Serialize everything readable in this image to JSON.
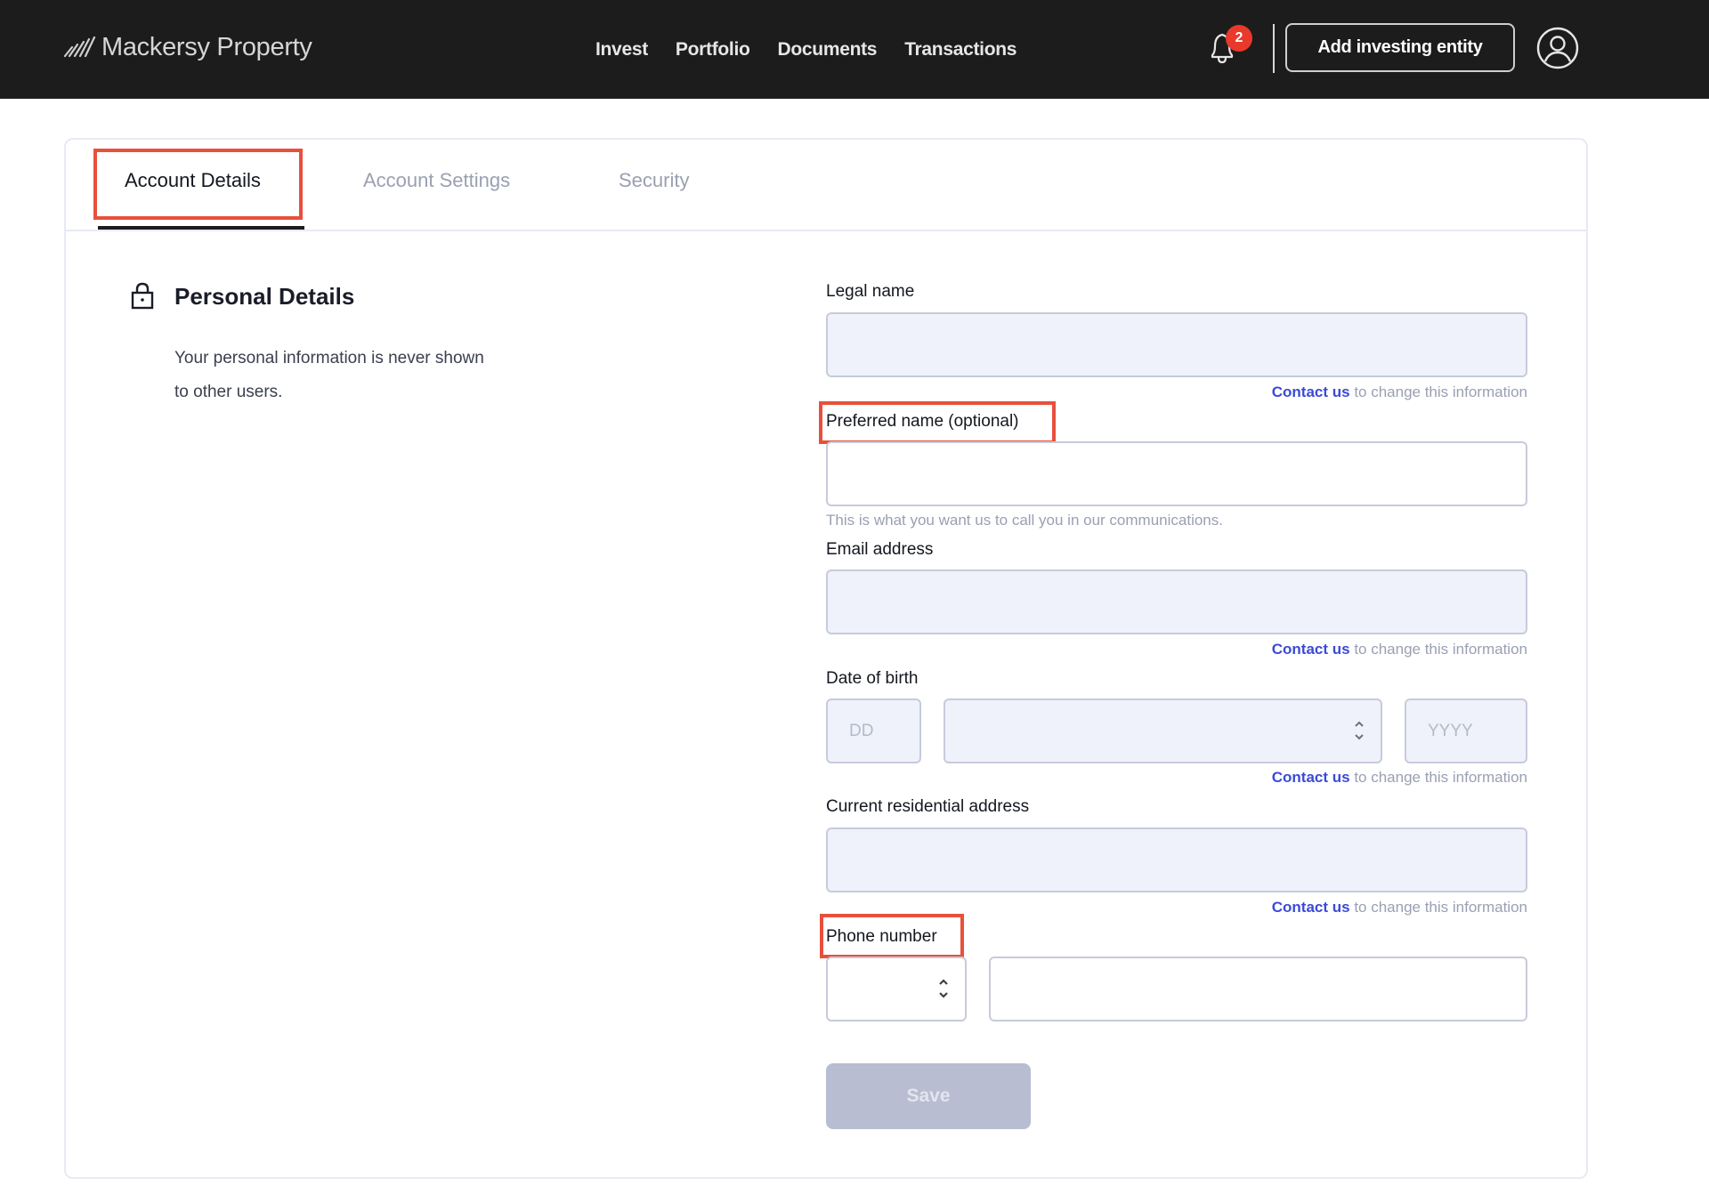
{
  "header": {
    "brand": "Mackersy Property",
    "nav": [
      {
        "label": "Invest"
      },
      {
        "label": "Portfolio"
      },
      {
        "label": "Documents"
      },
      {
        "label": "Transactions"
      }
    ],
    "notifications_count": "2",
    "add_entity_label": "Add investing entity",
    "icons": {
      "bell": "bell-icon",
      "avatar": "user-circle-icon",
      "logo": "diagonal-lines-logo"
    }
  },
  "tabs": [
    {
      "label": "Account Details",
      "active": true
    },
    {
      "label": "Account Settings",
      "active": false
    },
    {
      "label": "Security",
      "active": false
    }
  ],
  "section": {
    "title": "Personal Details",
    "description": "Your personal information is never shown to other users.",
    "icon": "lock-icon"
  },
  "form": {
    "legal_name": {
      "label": "Legal name",
      "value": ""
    },
    "preferred_name": {
      "label": "Preferred name (optional)",
      "value": "",
      "help": "This is what you want us to call you in our communications."
    },
    "email": {
      "label": "Email address",
      "value": ""
    },
    "dob": {
      "label": "Date of birth",
      "day_placeholder": "DD",
      "month_value": "",
      "year_placeholder": "YYYY"
    },
    "address": {
      "label": "Current residential address",
      "value": ""
    },
    "phone": {
      "label": "Phone number",
      "country_code": "",
      "number": ""
    },
    "contact_helper": {
      "link": "Contact us",
      "text": " to change this information"
    },
    "save_label": "Save"
  },
  "colors": {
    "header_bg": "#1c1c1c",
    "badge": "#e8392b",
    "link": "#3b4ad8",
    "highlight": "#e8503c",
    "disabled_button": "#b8bdd1",
    "readonly_field": "#eff2fb"
  }
}
